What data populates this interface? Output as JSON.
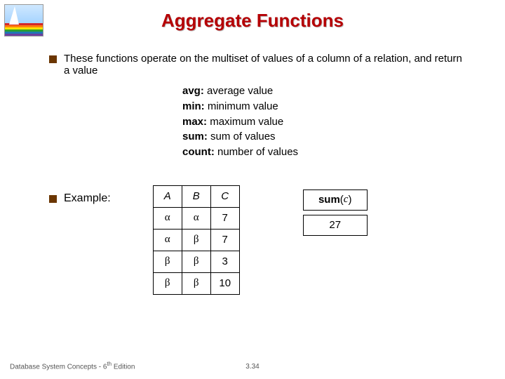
{
  "title": "Aggregate Functions",
  "intro": "These functions operate on the multiset of values of a column of a relation, and return a value",
  "functions": [
    {
      "name": "avg:",
      "desc": " average value"
    },
    {
      "name": "min:",
      "desc": "  minimum value"
    },
    {
      "name": "max:",
      "desc": "  maximum value"
    },
    {
      "name": "sum:",
      "desc": "  sum of values"
    },
    {
      "name": "count:",
      "desc": "  number of values"
    }
  ],
  "example_label": "Example:",
  "table": {
    "headers": [
      "A",
      "B",
      "C"
    ],
    "rows": [
      [
        "α",
        "α",
        "7"
      ],
      [
        "α",
        "β",
        "7"
      ],
      [
        "β",
        "β",
        "3"
      ],
      [
        "β",
        "β",
        "10"
      ]
    ]
  },
  "result": {
    "op": "sum",
    "arg_open": "(",
    "arg": "c",
    "arg_close": " )",
    "value": "27"
  },
  "footer": {
    "text_a": "Database System Concepts - 6",
    "text_sup": "th",
    "text_b": " Edition",
    "page": "3.34"
  }
}
